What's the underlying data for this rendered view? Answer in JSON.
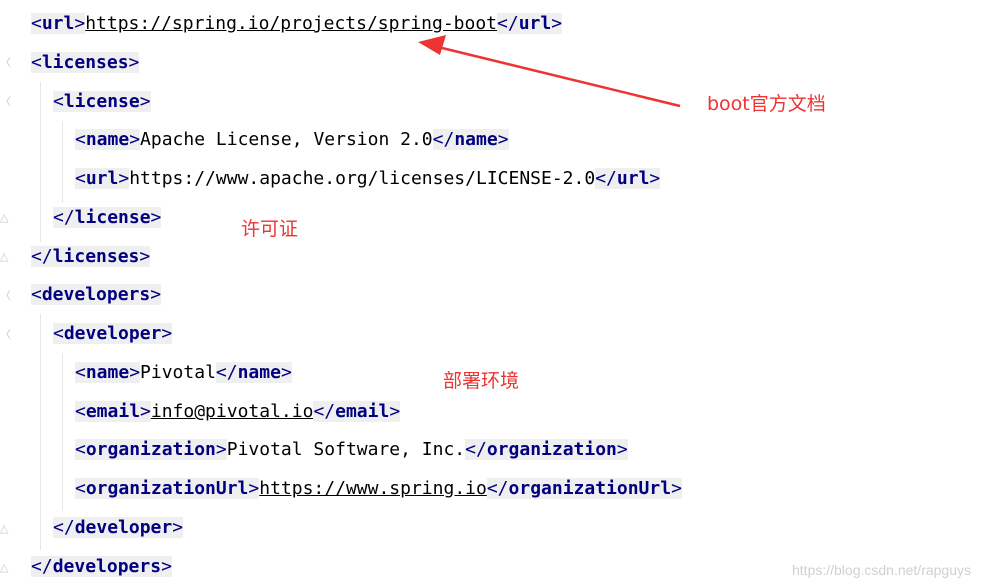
{
  "code": {
    "l1": {
      "open": "url",
      "text": "https://spring.io/projects/spring-boot",
      "close": "url"
    },
    "l2": {
      "open": "licenses"
    },
    "l3": {
      "open": "license"
    },
    "l4": {
      "open": "name",
      "text": "Apache License, Version 2.0",
      "close": "name"
    },
    "l5": {
      "open": "url",
      "text": "https://www.apache.org/licenses/LICENSE-2.0",
      "close": "url"
    },
    "l6": {
      "close": "license"
    },
    "l7": {
      "close": "licenses"
    },
    "l8": {
      "open": "developers"
    },
    "l9": {
      "open": "developer"
    },
    "l10": {
      "open": "name",
      "text": "Pivotal",
      "close": "name"
    },
    "l11": {
      "open": "email",
      "text": "info@pivotal.io",
      "close": "email"
    },
    "l12": {
      "open": "organization",
      "text": "Pivotal Software, Inc.",
      "close": "organization"
    },
    "l13": {
      "open": "organizationUrl",
      "text": "https://www.spring.io",
      "close": "organizationUrl"
    },
    "l14": {
      "close": "developer"
    },
    "l15": {
      "close": "developers"
    }
  },
  "annotations": {
    "boot_docs": "boot官方文档",
    "license": "许可证",
    "deploy_env": "部署环境",
    "arrow_color": "#ee3333"
  },
  "watermark": "https://blog.csdn.net/rapguys"
}
